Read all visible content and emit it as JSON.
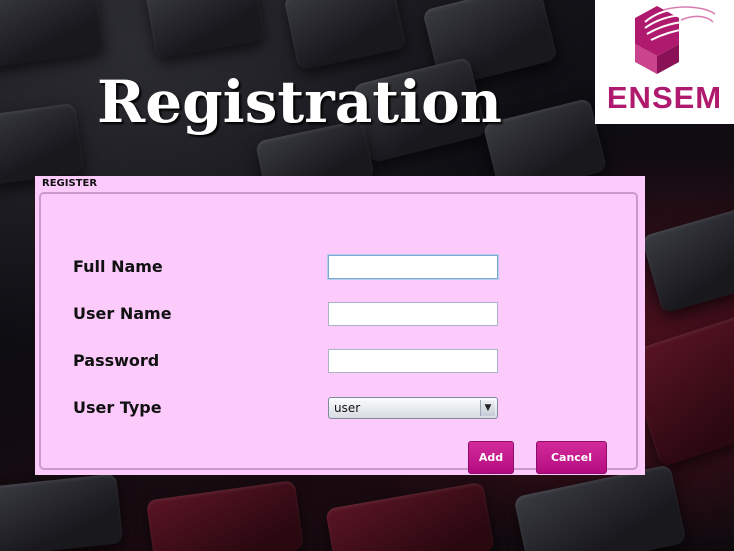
{
  "page": {
    "title": "Registration"
  },
  "logo": {
    "text": "ENSEM",
    "accent": "#b01a6e"
  },
  "panel": {
    "title": "REGISTER",
    "background": "#fccbfc"
  },
  "form": {
    "full_name": {
      "label": "Full Name",
      "value": ""
    },
    "user_name": {
      "label": "User Name",
      "value": ""
    },
    "password": {
      "label": "Password",
      "value": ""
    },
    "user_type": {
      "label": "User Type",
      "selected": "user"
    }
  },
  "buttons": {
    "add": "Add",
    "cancel": "Cancel",
    "color": "#c01a8c"
  }
}
